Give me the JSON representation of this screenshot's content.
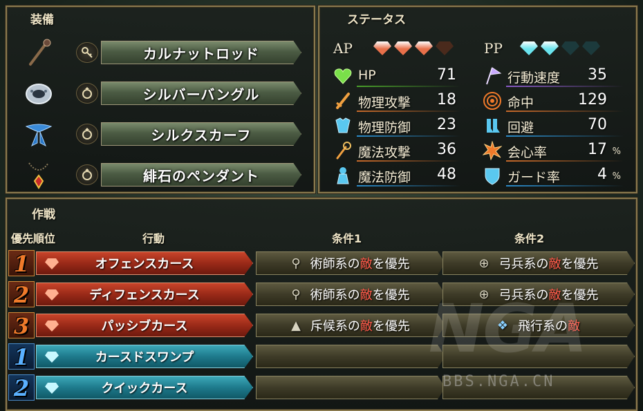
{
  "equipment": {
    "title": "装備",
    "items": [
      {
        "name": "カルナットロッド",
        "slot_icon": "key-icon",
        "item_icon": "rod-icon"
      },
      {
        "name": "シルバーバングル",
        "slot_icon": "ring-icon",
        "item_icon": "bangle-icon"
      },
      {
        "name": "シルクスカーフ",
        "slot_icon": "ring-icon",
        "item_icon": "scarf-icon"
      },
      {
        "name": "緋石のペンダント",
        "slot_icon": "ring-icon",
        "item_icon": "pendant-icon"
      }
    ]
  },
  "status": {
    "title": "ステータス",
    "ap_label": "AP",
    "pp_label": "PP",
    "ap": {
      "filled": 3,
      "total": 4
    },
    "pp": {
      "filled": 2,
      "total": 4
    },
    "left": [
      {
        "name": "HP",
        "value": "71",
        "icon": "heart-icon"
      },
      {
        "name": "物理攻撃",
        "value": "18",
        "icon": "sword-icon"
      },
      {
        "name": "物理防御",
        "value": "23",
        "icon": "armor-icon"
      },
      {
        "name": "魔法攻撃",
        "value": "36",
        "icon": "staff-icon"
      },
      {
        "name": "魔法防御",
        "value": "48",
        "icon": "robe-icon"
      }
    ],
    "right": [
      {
        "name": "行動速度",
        "value": "35",
        "unit": "",
        "icon": "flag-icon"
      },
      {
        "name": "命中",
        "value": "129",
        "unit": "",
        "icon": "target-icon"
      },
      {
        "name": "回避",
        "value": "70",
        "unit": "",
        "icon": "boots-icon"
      },
      {
        "name": "会心率",
        "value": "17",
        "unit": "%",
        "icon": "burst-icon"
      },
      {
        "name": "ガード率",
        "value": "4",
        "unit": "%",
        "icon": "shield-icon"
      }
    ]
  },
  "tactics": {
    "title": "作戦",
    "headers": {
      "priority": "優先順位",
      "action": "行動",
      "cond1": "条件1",
      "cond2": "条件2"
    },
    "rows": [
      {
        "num": "1",
        "type": "red",
        "action": "オフェンスカース",
        "cond1": {
          "icon": "pin-icon",
          "pre": "術師系の",
          "enemy": "敵",
          "post": "を優先"
        },
        "cond2": {
          "icon": "bow-icon",
          "pre": "弓兵系の",
          "enemy": "敵",
          "post": "を優先"
        }
      },
      {
        "num": "2",
        "type": "red",
        "action": "ディフェンスカース",
        "cond1": {
          "icon": "pin-icon",
          "pre": "術師系の",
          "enemy": "敵",
          "post": "を優先"
        },
        "cond2": {
          "icon": "bow-icon",
          "pre": "弓兵系の",
          "enemy": "敵",
          "post": "を優先"
        }
      },
      {
        "num": "3",
        "type": "red",
        "action": "パッシブカース",
        "cond1": {
          "icon": "cloak-icon",
          "pre": "斥候系の",
          "enemy": "敵",
          "post": "を優先"
        },
        "cond2": {
          "icon": "wing-icon",
          "pre": "飛行系の",
          "enemy": "敵",
          "post": ""
        }
      },
      {
        "num": "1",
        "type": "blue",
        "action": "カースドスワンプ",
        "cond1": null,
        "cond2": null
      },
      {
        "num": "2",
        "type": "blue",
        "action": "クイックカース",
        "cond1": null,
        "cond2": null
      }
    ]
  },
  "watermark": {
    "logo": "NGA",
    "url": "BBS.NGA.CN"
  },
  "colors": {
    "ap_gem": "#e8704a",
    "pp_gem": "#6ae4ee",
    "gem_empty": "#4a2a1c",
    "pp_empty": "#1c3a3c",
    "enemy": "#ff5a4a"
  }
}
